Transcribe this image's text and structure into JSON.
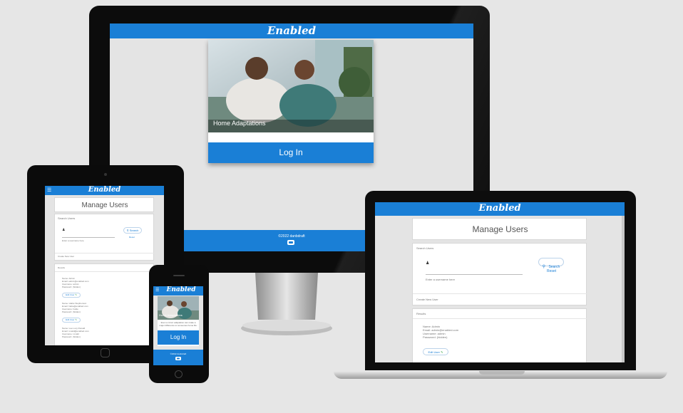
{
  "brand": "Enabled",
  "colors": {
    "primary": "#1a7fd6",
    "page_bg": "#e4e4e4",
    "backdrop": "#e6e6e6"
  },
  "desktop": {
    "hero_label": "Home Adaptations",
    "tagline": "Even a minor adaptation can make a major difference to someones home life.",
    "login_button": "Log In",
    "footer_copyright": "©2022 danbdraft",
    "footer_icon": "github-icon"
  },
  "manage_users": {
    "title": "Manage Users",
    "search_section_label": "Search Users",
    "search_button": "Search",
    "reset_link": "Reset",
    "search_hint": "Enter a username here",
    "create_user_label": "Create New User",
    "results_label": "Results",
    "results": [
      {
        "name": "Name: Admin",
        "email": "Email: admin@enabled.com",
        "username": "Username: admin",
        "password": "Password: (hidden)"
      },
      {
        "name": "Name: Hattie Stephenson",
        "email": "Email: hattie@enabled.com",
        "username": "Username: hattie",
        "password": "Password: (hidden)"
      },
      {
        "name": "Name: Lee Lucy Ronald",
        "email": "Email: ronald@enabled.com",
        "username": "Username: ronald",
        "password": "Password: (hidden)"
      }
    ],
    "edit_user_button": "Edit User"
  },
  "phone": {
    "hero_label": "Home Adaptations",
    "tagline": "Even a minor adaptation can make a major difference to someones home life.",
    "login_button": "Log In",
    "footer_copyright": "©2022 danbdraft"
  }
}
